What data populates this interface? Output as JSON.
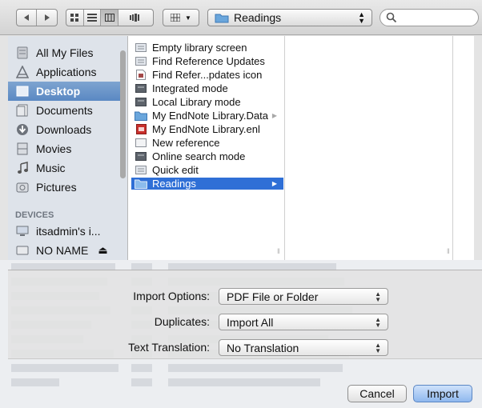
{
  "toolbar": {
    "nav": {
      "back_icon": "back-arrow-icon",
      "forward_icon": "forward-arrow-icon"
    },
    "view_modes": [
      "icon-view-icon",
      "list-view-icon",
      "column-view-icon",
      "coverflow-view-icon"
    ],
    "selected_view": "column-view-icon",
    "arrange_icon": "arrange-grid-icon",
    "location": {
      "label": "Readings",
      "icon": "folder-icon"
    },
    "search": {
      "value": "",
      "placeholder": ""
    }
  },
  "sidebar": {
    "favorites": [
      {
        "label": "All My Files",
        "icon": "all-files-icon"
      },
      {
        "label": "Applications",
        "icon": "applications-icon"
      },
      {
        "label": "Desktop",
        "icon": "desktop-icon",
        "selected": true
      },
      {
        "label": "Documents",
        "icon": "documents-icon"
      },
      {
        "label": "Downloads",
        "icon": "downloads-icon"
      },
      {
        "label": "Movies",
        "icon": "movies-icon"
      },
      {
        "label": "Music",
        "icon": "music-icon"
      },
      {
        "label": "Pictures",
        "icon": "pictures-icon"
      }
    ],
    "devices_header": "DEVICES",
    "devices": [
      {
        "label": "itsadmin's i...",
        "icon": "computer-icon"
      },
      {
        "label": "NO NAME",
        "icon": "drive-icon",
        "eject": "⏏"
      }
    ]
  },
  "files": [
    {
      "name": "Empty library screen",
      "icon": "image-file-icon"
    },
    {
      "name": "Find Reference Updates",
      "icon": "image-file-icon"
    },
    {
      "name": "Find Refer...pdates icon",
      "icon": "document-file-icon"
    },
    {
      "name": "Integrated mode",
      "icon": "image-file-icon"
    },
    {
      "name": "Local Library mode",
      "icon": "image-file-icon"
    },
    {
      "name": "My EndNote Library.Data",
      "icon": "folder-icon",
      "has_children": true
    },
    {
      "name": "My EndNote Library.enl",
      "icon": "endnote-library-icon"
    },
    {
      "name": "New reference",
      "icon": "image-file-icon"
    },
    {
      "name": "Online search mode",
      "icon": "image-file-icon"
    },
    {
      "name": "Quick edit",
      "icon": "image-file-icon"
    },
    {
      "name": "Readings",
      "icon": "folder-icon",
      "has_children": true,
      "selected": true
    }
  ],
  "options": {
    "import_options": {
      "label": "Import Options:",
      "value": "PDF File or Folder"
    },
    "duplicates": {
      "label": "Duplicates:",
      "value": "Import All"
    },
    "text_translation": {
      "label": "Text Translation:",
      "value": "No Translation"
    }
  },
  "buttons": {
    "cancel": "Cancel",
    "import": "Import"
  },
  "colors": {
    "selection": "#2f6fd6",
    "sidebar_selection": "#6b95c9",
    "sidebar_bg": "#dee3ea"
  }
}
